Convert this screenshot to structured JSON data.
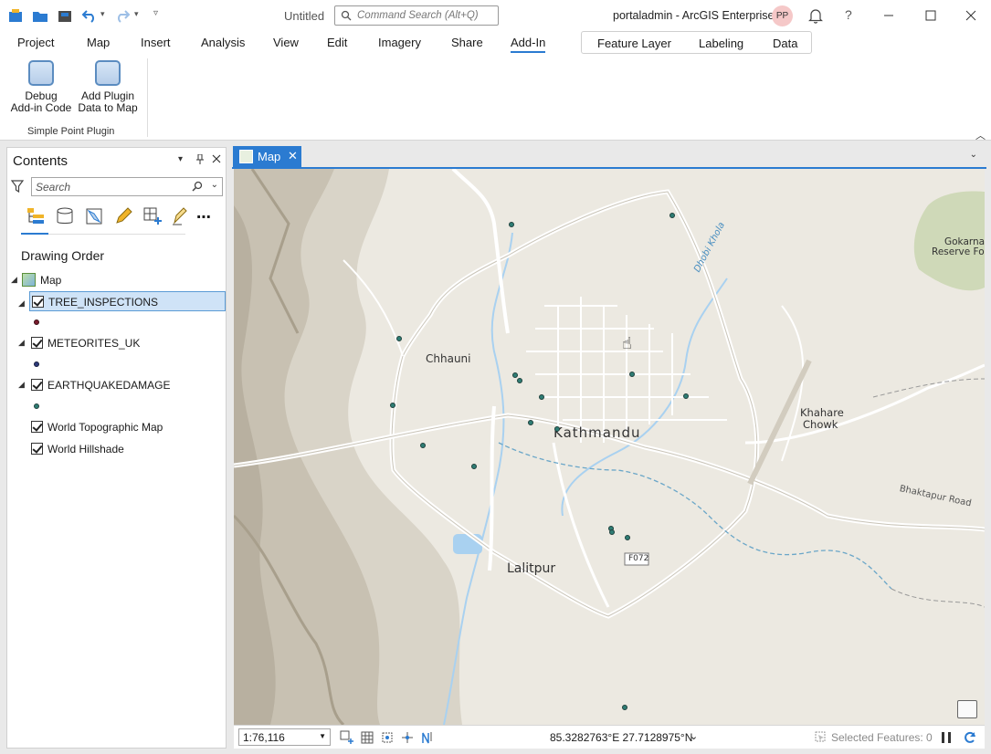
{
  "titlebar": {
    "document_title": "Untitled",
    "command_search_placeholder": "Command Search (Alt+Q)",
    "portal": "portaladmin - ArcGIS Enterprise",
    "avatar_initials": "PP"
  },
  "ribbon": {
    "tabs": [
      "Project",
      "Map",
      "Insert",
      "Analysis",
      "View",
      "Edit",
      "Imagery",
      "Share",
      "Add-In"
    ],
    "active_tab": "Add-In",
    "contextual_tabs": [
      "Feature Layer",
      "Labeling",
      "Data"
    ],
    "buttons": [
      {
        "line1": "Debug",
        "line2": "Add-in Code"
      },
      {
        "line1": "Add Plugin",
        "line2": "Data to Map"
      }
    ],
    "group_label": "Simple Point Plugin"
  },
  "contents": {
    "title": "Contents",
    "search_placeholder": "Search",
    "heading": "Drawing Order",
    "map_name": "Map",
    "layers": [
      {
        "name": "TREE_INSPECTIONS",
        "checked": true,
        "selected": true,
        "symbol_color": "#7a1d2e"
      },
      {
        "name": "METEORITES_UK",
        "checked": true,
        "selected": false,
        "symbol_color": "#2d3a7a"
      },
      {
        "name": "EARTHQUAKEDAMAGE",
        "checked": true,
        "selected": false,
        "symbol_color": "#2f7d74"
      },
      {
        "name": "World Topographic Map",
        "checked": true,
        "selected": false
      },
      {
        "name": "World Hillshade",
        "checked": true,
        "selected": false
      }
    ]
  },
  "map_view": {
    "tab_label": "Map",
    "places": {
      "kathmandu": "Kathmandu",
      "lalitpur": "Lalitpur",
      "chhauni": "Chhauni",
      "khahare_line1": "Khahare",
      "khahare_line2": "Chowk",
      "gokarna_line1": "Gokarna",
      "gokarna_line2": "Reserve Fore",
      "dhobi_khola": "Dhobi Khola",
      "bhaktapur_road": "Bhaktapur Road",
      "route": "F072"
    }
  },
  "statusbar": {
    "scale": "1:76,116",
    "coordinates": "85.3282763°E 27.7128975°N",
    "selected_features": "Selected Features: 0"
  }
}
